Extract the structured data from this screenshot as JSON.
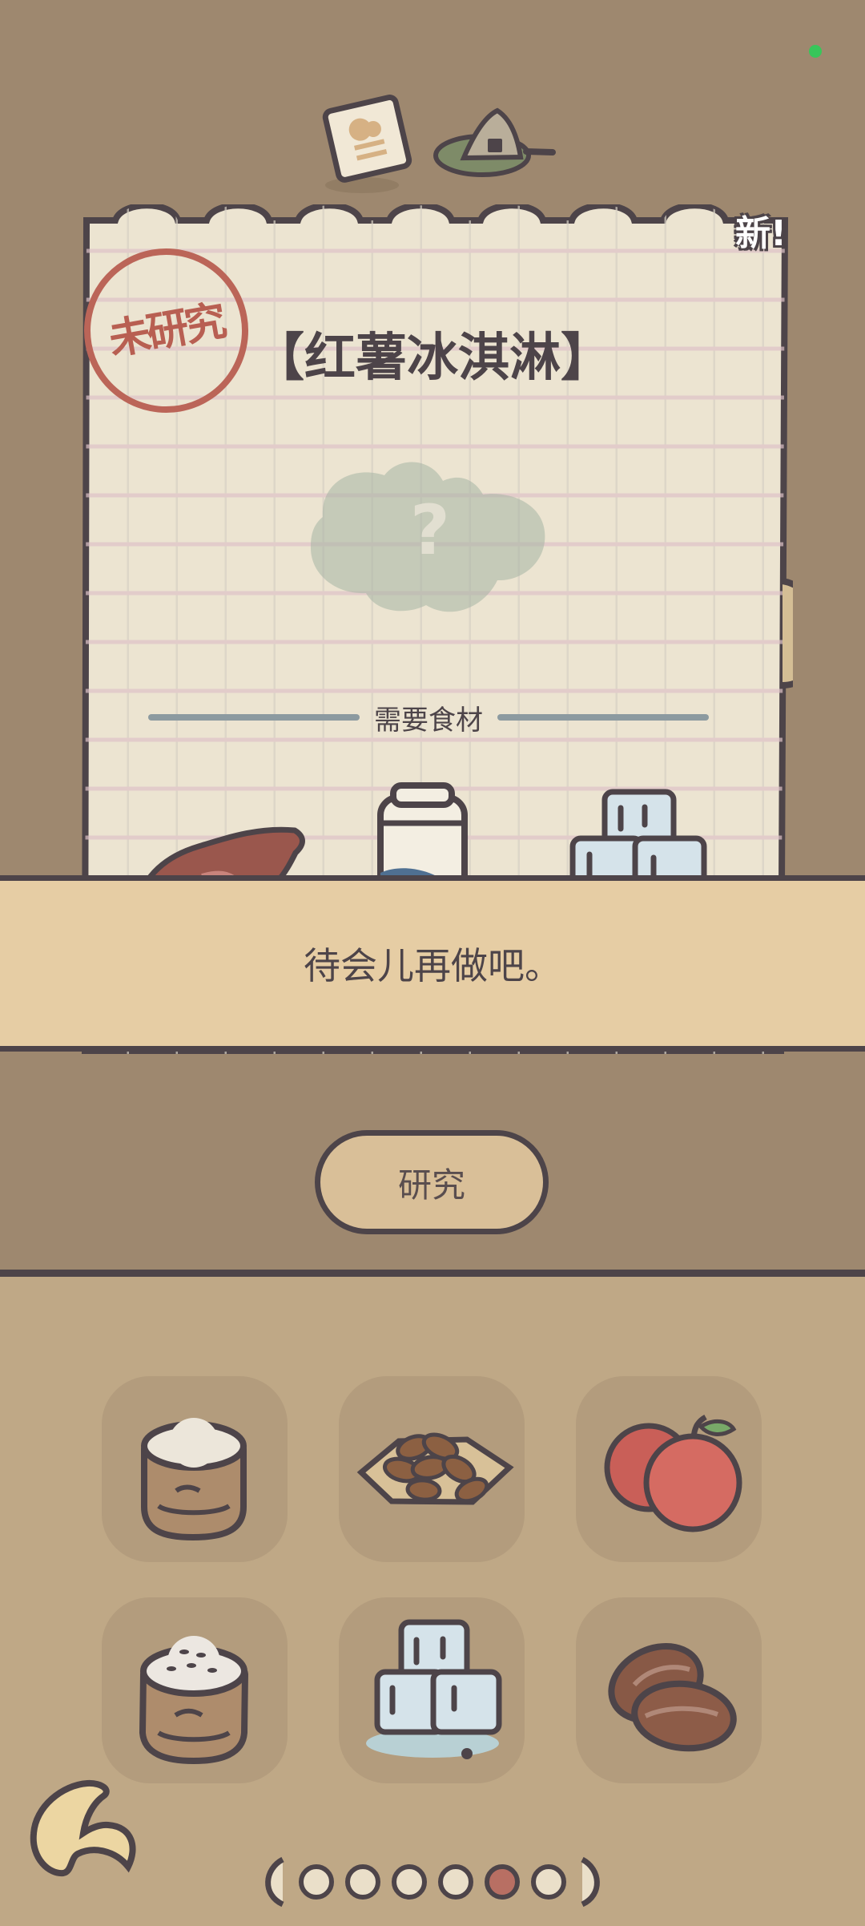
{
  "status_indicator": {
    "color": "#38c65a"
  },
  "top_icons": [
    {
      "name": "recipe-card-icon"
    },
    {
      "name": "rice-ball-icon"
    }
  ],
  "recipe": {
    "stamp_text": "未研究",
    "new_badge": "新!",
    "title": "【红薯冰淇淋】",
    "mystery_icon": "question-mark-icon",
    "ingredients_label": "需要食材",
    "ingredients": [
      {
        "name": "sweet-potato-icon"
      },
      {
        "name": "milk-carton-icon"
      },
      {
        "name": "ice-cubes-icon"
      }
    ]
  },
  "message": {
    "text": "待会儿再做吧。"
  },
  "buttons": {
    "research_label": "研究"
  },
  "inventory": {
    "items": [
      {
        "name": "flour-bag-icon"
      },
      {
        "name": "almonds-icon"
      },
      {
        "name": "apples-icon"
      },
      {
        "name": "rice-sack-icon"
      },
      {
        "name": "ice-cubes-icon"
      },
      {
        "name": "walnuts-icon"
      }
    ],
    "pager": {
      "pages": 6,
      "active_page": 5
    }
  },
  "colors": {
    "background_top": "#9e886f",
    "paper": "#ece4d1",
    "message_bar": "#e6cda4",
    "inventory_bg": "#bfa886",
    "outline": "#4d4449"
  }
}
